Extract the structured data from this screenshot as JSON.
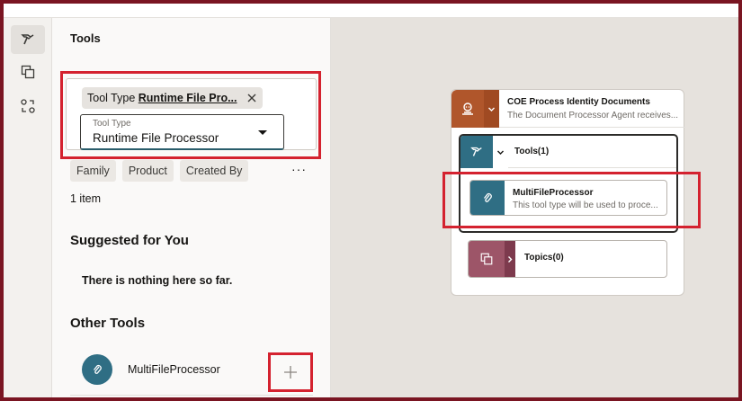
{
  "rail": {
    "items": [
      {
        "icon": "hammer-icon",
        "active": true
      },
      {
        "icon": "copy-stack-icon",
        "active": false
      },
      {
        "icon": "connect-nodes-icon",
        "active": false
      }
    ]
  },
  "panel": {
    "title": "Tools",
    "filter": {
      "chip_prefix": "Tool Type ",
      "chip_value": "Runtime File Pro...",
      "select_label": "Tool Type",
      "select_value": "Runtime File Processor"
    },
    "facets": [
      "Family",
      "Product",
      "Created By"
    ],
    "more_label": "···",
    "count": "1 item",
    "suggested_heading": "Suggested for You",
    "empty_text": "There is nothing here so far.",
    "other_heading": "Other Tools",
    "tools": [
      {
        "name": "MultiFileProcessor",
        "icon": "paperclip-icon",
        "add_icon": "plus-icon"
      }
    ]
  },
  "canvas": {
    "agent": {
      "name": "COE Process Identity Documents",
      "description": "The Document Processor Agent receives...",
      "icon": "agent-icon",
      "color": "#b0562b"
    },
    "tools_group": {
      "label": "Tools(1)",
      "color": "#2f6e84",
      "tool": {
        "name": "MultiFileProcessor",
        "description": "This tool type will be used to proce..."
      }
    },
    "topics_group": {
      "label": "Topics(0)",
      "color": "#9d5568"
    }
  },
  "colors": {
    "highlight": "#d4222f",
    "frame": "#7a1522",
    "accent": "#2f6e84"
  }
}
